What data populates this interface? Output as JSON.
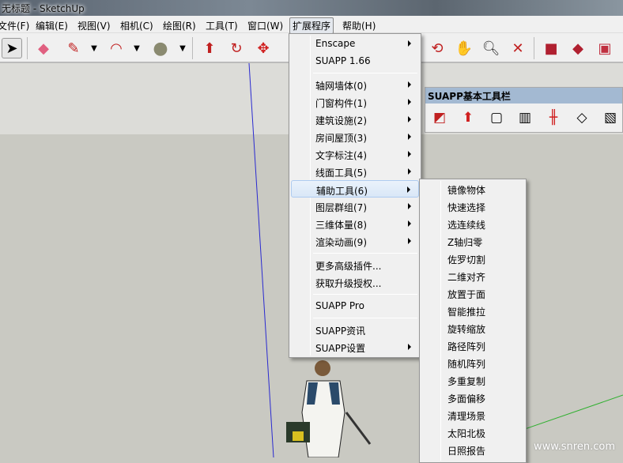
{
  "window": {
    "title": "无标题 - SketchUp"
  },
  "menubar": [
    {
      "label": "文件(F)"
    },
    {
      "label": "编辑(E)"
    },
    {
      "label": "视图(V)"
    },
    {
      "label": "相机(C)"
    },
    {
      "label": "绘图(R)"
    },
    {
      "label": "工具(T)"
    },
    {
      "label": "窗口(W)"
    },
    {
      "label": "扩展程序"
    },
    {
      "label": "帮助(H)"
    }
  ],
  "toolbar": {
    "icons": [
      "select-icon",
      "eraser-icon",
      "pencil-icon",
      "arc-icon",
      "circle-icon",
      "push-pull-icon",
      "follow-me-icon",
      "move-icon",
      "rotate-icon",
      "orbit-icon",
      "pan-icon",
      "zoom-icon",
      "zoom-extents-icon",
      "warehouse-icon",
      "extension-warehouse-icon",
      "share-model-icon"
    ]
  },
  "extensions_menu": {
    "items": [
      {
        "label": "Enscape",
        "submenu": true
      },
      {
        "label": "SUAPP 1.66",
        "submenu": false
      },
      {
        "label": "轴网墙体(0)",
        "submenu": true
      },
      {
        "label": "门窗构件(1)",
        "submenu": true
      },
      {
        "label": "建筑设施(2)",
        "submenu": true
      },
      {
        "label": "房间屋顶(3)",
        "submenu": true
      },
      {
        "label": "文字标注(4)",
        "submenu": true
      },
      {
        "label": "线面工具(5)",
        "submenu": true
      },
      {
        "label": "辅助工具(6)",
        "submenu": true,
        "highlighted": true
      },
      {
        "label": "图层群组(7)",
        "submenu": true
      },
      {
        "label": "三维体量(8)",
        "submenu": true
      },
      {
        "label": "渲染动画(9)",
        "submenu": true
      },
      {
        "label": "更多高级插件...",
        "submenu": false
      },
      {
        "label": "获取升级授权...",
        "submenu": false
      },
      {
        "label": "SUAPP Pro",
        "submenu": false
      },
      {
        "label": "SUAPP资讯",
        "submenu": false
      },
      {
        "label": "SUAPP设置",
        "submenu": true
      }
    ]
  },
  "aux_tools_submenu": {
    "items": [
      "镜像物体",
      "快速选择",
      "选连续线",
      "Z轴归零",
      "佐罗切割",
      "二维对齐",
      "放置于面",
      "智能推拉",
      "旋转缩放",
      "路径阵列",
      "随机阵列",
      "多重复制",
      "多面偏移",
      "清理场景",
      "太阳北极",
      "日照报告"
    ]
  },
  "suapp_toolbar": {
    "title": "SUAPP基本工具栏",
    "icons": [
      "wall-icon",
      "door-icon",
      "window-icon",
      "curtain-wall-icon",
      "railing-icon",
      "stairs-icon",
      "ramp-icon"
    ]
  },
  "watermark": "www.snren.com"
}
